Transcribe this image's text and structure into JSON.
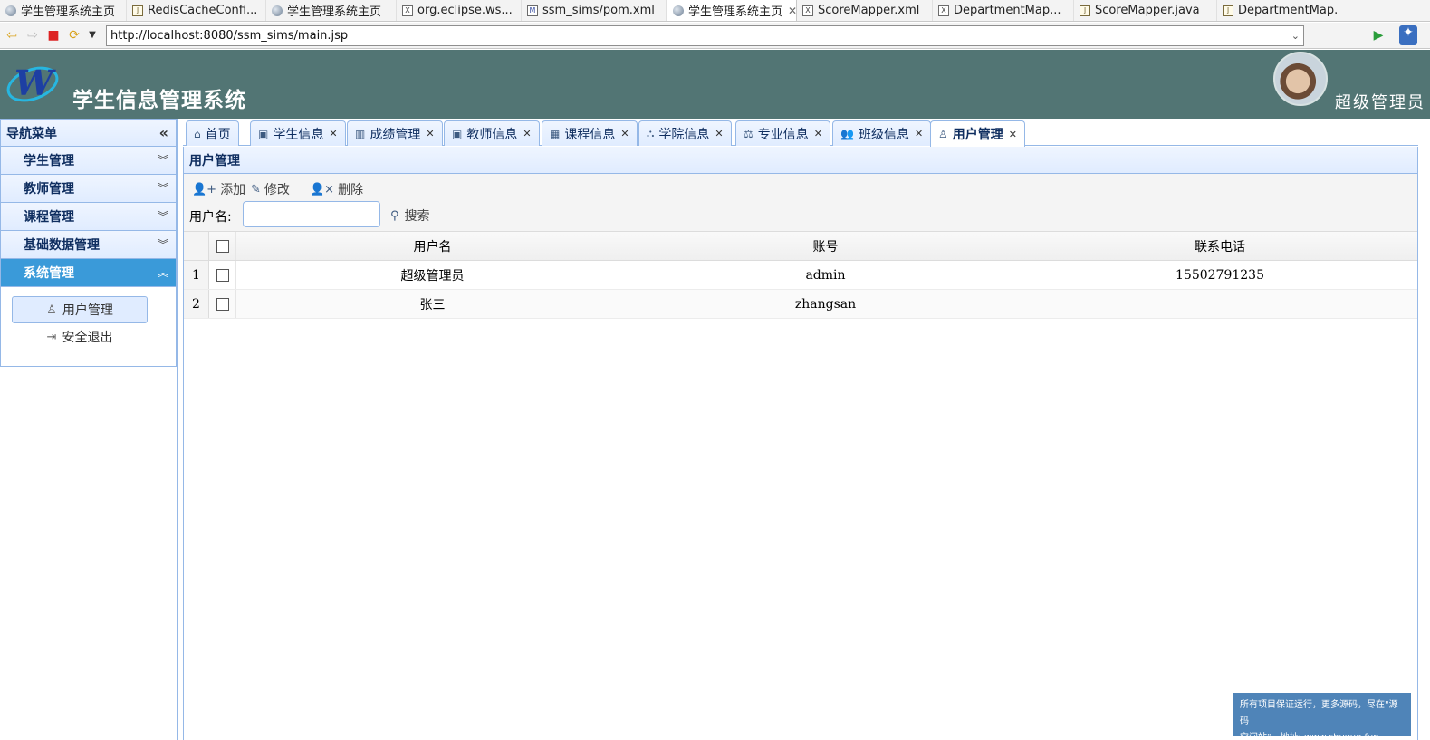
{
  "editor_tabs": [
    {
      "label": "学生管理系统主页",
      "icon": "globe"
    },
    {
      "label": "RedisCacheConfi...",
      "icon": "java"
    },
    {
      "label": "学生管理系统主页",
      "icon": "globe"
    },
    {
      "label": "org.eclipse.ws...",
      "icon": "xml"
    },
    {
      "label": "ssm_sims/pom.xml",
      "icon": "maven"
    },
    {
      "label": "学生管理系统主页",
      "icon": "globe",
      "active": true
    },
    {
      "label": "ScoreMapper.xml",
      "icon": "xml"
    },
    {
      "label": "DepartmentMap...",
      "icon": "xml"
    },
    {
      "label": "ScoreMapper.java",
      "icon": "java"
    },
    {
      "label": "DepartmentMap...",
      "icon": "java"
    }
  ],
  "browser": {
    "url": "http://localhost:8080/ssm_sims/main.jsp"
  },
  "header": {
    "title": "学生信息管理系统",
    "admin_name": "超级管理员",
    "bg_color": "#527574"
  },
  "sidebar": {
    "title": "导航菜单",
    "groups": [
      {
        "label": "学生管理"
      },
      {
        "label": "教师管理"
      },
      {
        "label": "课程管理"
      },
      {
        "label": "基础数据管理"
      },
      {
        "label": "系统管理",
        "active": true
      }
    ],
    "sub_items": [
      {
        "label": "用户管理",
        "icon": "user-icon",
        "selected": true
      },
      {
        "label": "安全退出",
        "icon": "sign-out-icon"
      }
    ]
  },
  "main_tabs": [
    {
      "label": "首页",
      "icon": "home-icon"
    },
    {
      "label": "学生信息",
      "icon": "id-card-icon"
    },
    {
      "label": "成绩管理",
      "icon": "bar-chart-icon"
    },
    {
      "label": "教师信息",
      "icon": "id-card-icon"
    },
    {
      "label": "课程信息",
      "icon": "calendar-icon"
    },
    {
      "label": "学院信息",
      "icon": "sitemap-icon"
    },
    {
      "label": "专业信息",
      "icon": "balance-icon"
    },
    {
      "label": "班级信息",
      "icon": "users-icon"
    },
    {
      "label": "用户管理",
      "icon": "user-icon",
      "active": true
    }
  ],
  "panel": {
    "title": "用户管理"
  },
  "toolbar": {
    "add_label": "添加",
    "edit_label": "修改",
    "delete_label": "删除",
    "search_label": "用户名:",
    "search_value": "",
    "search_button": "搜索"
  },
  "grid": {
    "columns": [
      "用户名",
      "账号",
      "联系电话"
    ],
    "rows": [
      {
        "num": "1",
        "username": "超级管理员",
        "account": "admin",
        "phone": "15502791235"
      },
      {
        "num": "2",
        "username": "张三",
        "account": "zhangsan",
        "phone": ""
      }
    ]
  },
  "watermark": {
    "line1": "所有项目保证运行，更多源码，尽在\"源码",
    "line2": "空间站\"，地址: www.shuyue.fun"
  }
}
